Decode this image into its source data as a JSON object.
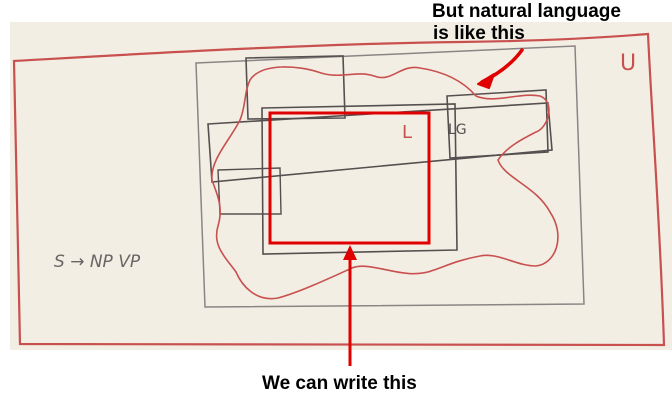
{
  "captions": {
    "natural_language_line1": "But natural language",
    "natural_language_line2": "is like this",
    "we_can_write": "We can write this"
  },
  "board": {
    "handwritten_formula": "S → NP VP",
    "region_label_L": "L",
    "region_label_LG": "LG",
    "region_label_U": "U"
  },
  "colors": {
    "background": "#f3eee4",
    "pen_dark": "#555050",
    "pen_red": "#c8504f",
    "annotation_red": "#e00000",
    "caption_text": "#000000"
  }
}
